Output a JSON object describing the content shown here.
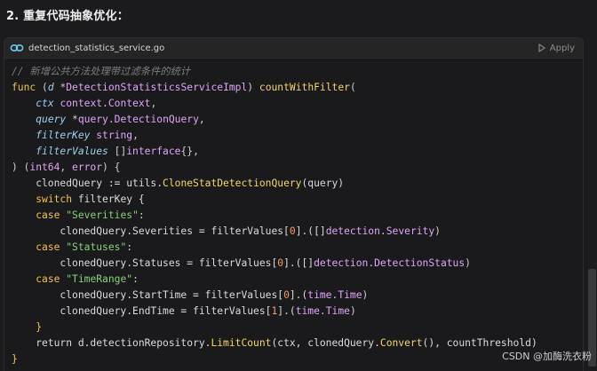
{
  "heading": "2. 重复代码抽象优化：",
  "code_block": {
    "file_name": "detection_statistics_service.go",
    "apply_label": "Apply",
    "lines": [
      [
        {
          "t": "// 新增公共方法处理带过滤条件的统计",
          "c": "cm"
        }
      ],
      [
        {
          "t": "func",
          "c": "kw"
        },
        {
          "t": " (",
          "c": "pu"
        },
        {
          "t": "d",
          "c": "pm"
        },
        {
          "t": " *",
          "c": "pu"
        },
        {
          "t": "DetectionStatisticsServiceImpl",
          "c": "ty"
        },
        {
          "t": ") ",
          "c": "pu"
        },
        {
          "t": "countWithFilter",
          "c": "fn"
        },
        {
          "t": "(",
          "c": "pu"
        }
      ],
      [
        {
          "t": "    ",
          "c": "pu"
        },
        {
          "t": "ctx",
          "c": "pm"
        },
        {
          "t": " ",
          "c": "pu"
        },
        {
          "t": "context",
          "c": "pk"
        },
        {
          "t": ".",
          "c": "pu"
        },
        {
          "t": "Context",
          "c": "ty"
        },
        {
          "t": ",",
          "c": "pu"
        }
      ],
      [
        {
          "t": "    ",
          "c": "pu"
        },
        {
          "t": "query",
          "c": "pm"
        },
        {
          "t": " *",
          "c": "pu"
        },
        {
          "t": "query",
          "c": "pk"
        },
        {
          "t": ".",
          "c": "pu"
        },
        {
          "t": "DetectionQuery",
          "c": "ty"
        },
        {
          "t": ",",
          "c": "pu"
        }
      ],
      [
        {
          "t": "    ",
          "c": "pu"
        },
        {
          "t": "filterKey",
          "c": "pm"
        },
        {
          "t": " ",
          "c": "pu"
        },
        {
          "t": "string",
          "c": "ty"
        },
        {
          "t": ",",
          "c": "pu"
        }
      ],
      [
        {
          "t": "    ",
          "c": "pu"
        },
        {
          "t": "filterValues",
          "c": "pm"
        },
        {
          "t": " []",
          "c": "pu"
        },
        {
          "t": "interface",
          "c": "ty"
        },
        {
          "t": "{},",
          "c": "pu"
        }
      ],
      [
        {
          "t": ") (",
          "c": "pu"
        },
        {
          "t": "int64",
          "c": "ty"
        },
        {
          "t": ", ",
          "c": "pu"
        },
        {
          "t": "error",
          "c": "ty"
        },
        {
          "t": ") {",
          "c": "pu"
        }
      ],
      [
        {
          "t": "    clonedQuery := utils.",
          "c": "id"
        },
        {
          "t": "CloneStatDetectionQuery",
          "c": "fn"
        },
        {
          "t": "(query)",
          "c": "id"
        }
      ],
      [
        {
          "t": "    ",
          "c": "pu"
        },
        {
          "t": "switch",
          "c": "kw"
        },
        {
          "t": " filterKey {",
          "c": "id"
        }
      ],
      [
        {
          "t": "    ",
          "c": "pu"
        },
        {
          "t": "case",
          "c": "kw"
        },
        {
          "t": " ",
          "c": "pu"
        },
        {
          "t": "\"Severities\"",
          "c": "st"
        },
        {
          "t": ":",
          "c": "pu"
        }
      ],
      [
        {
          "t": "        clonedQuery.Severities = filterValues[",
          "c": "id"
        },
        {
          "t": "0",
          "c": "nu"
        },
        {
          "t": "].([]",
          "c": "id"
        },
        {
          "t": "detection",
          "c": "pk"
        },
        {
          "t": ".",
          "c": "pu"
        },
        {
          "t": "Severity",
          "c": "ty"
        },
        {
          "t": ")",
          "c": "pu"
        }
      ],
      [
        {
          "t": "    ",
          "c": "pu"
        },
        {
          "t": "case",
          "c": "kw"
        },
        {
          "t": " ",
          "c": "pu"
        },
        {
          "t": "\"Statuses\"",
          "c": "st"
        },
        {
          "t": ":",
          "c": "pu"
        }
      ],
      [
        {
          "t": "        clonedQuery.Statuses = filterValues[",
          "c": "id"
        },
        {
          "t": "0",
          "c": "nu"
        },
        {
          "t": "].([]",
          "c": "id"
        },
        {
          "t": "detection",
          "c": "pk"
        },
        {
          "t": ".",
          "c": "pu"
        },
        {
          "t": "DetectionStatus",
          "c": "ty"
        },
        {
          "t": ")",
          "c": "pu"
        }
      ],
      [
        {
          "t": "    ",
          "c": "pu"
        },
        {
          "t": "case",
          "c": "kw"
        },
        {
          "t": " ",
          "c": "pu"
        },
        {
          "t": "\"TimeRange\"",
          "c": "st"
        },
        {
          "t": ":",
          "c": "pu"
        }
      ],
      [
        {
          "t": "        clonedQuery.StartTime = filterValues[",
          "c": "id"
        },
        {
          "t": "0",
          "c": "nu"
        },
        {
          "t": "].(",
          "c": "id"
        },
        {
          "t": "time",
          "c": "pk"
        },
        {
          "t": ".",
          "c": "pu"
        },
        {
          "t": "Time",
          "c": "ty"
        },
        {
          "t": ")",
          "c": "pu"
        }
      ],
      [
        {
          "t": "        clonedQuery.EndTime = filterValues[",
          "c": "id"
        },
        {
          "t": "1",
          "c": "nu"
        },
        {
          "t": "].(",
          "c": "id"
        },
        {
          "t": "time",
          "c": "pk"
        },
        {
          "t": ".",
          "c": "pu"
        },
        {
          "t": "Time",
          "c": "ty"
        },
        {
          "t": ")",
          "c": "pu"
        }
      ],
      [
        {
          "t": "    }",
          "c": "kw"
        }
      ],
      [
        {
          "t": "    return d.detectionRepository.",
          "c": "id"
        },
        {
          "t": "LimitCount",
          "c": "fn"
        },
        {
          "t": "(ctx, clonedQuery.",
          "c": "id"
        },
        {
          "t": "Convert",
          "c": "fn"
        },
        {
          "t": "(), countThreshold)",
          "c": "id"
        }
      ],
      [
        {
          "t": "}",
          "c": "kw"
        }
      ]
    ]
  },
  "watermark": "CSDN @加酶洗衣粉",
  "colors": {
    "background": "#1b1b1d",
    "keyword": "#f0c44f",
    "type": "#e0a6f8",
    "string": "#88d17e",
    "number": "#f29a6c",
    "param": "#9fd0f0",
    "comment": "#7d7d7d"
  },
  "icons": {
    "file_icon": "go-file-icon",
    "apply_icon": "play-icon"
  }
}
